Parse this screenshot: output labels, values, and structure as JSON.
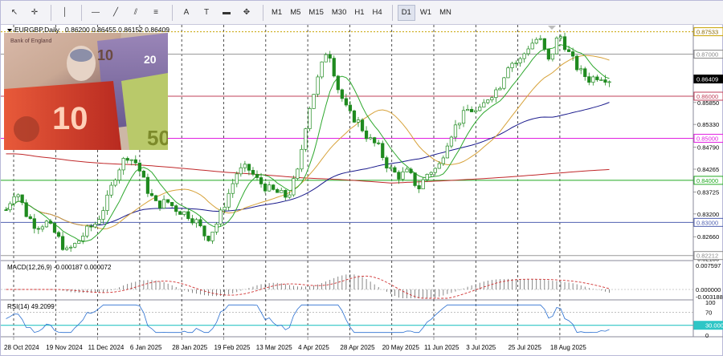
{
  "toolbar": {
    "tools": [
      {
        "name": "cursor-icon",
        "glyph": "↖"
      },
      {
        "name": "crosshair-icon",
        "glyph": "✛"
      },
      {
        "name": "vertical-line-icon",
        "glyph": "│"
      },
      {
        "name": "horizontal-line-icon",
        "glyph": "—"
      },
      {
        "name": "trendline-icon",
        "glyph": "╱"
      },
      {
        "name": "channel-icon",
        "glyph": "⫽"
      },
      {
        "name": "fibonacci-icon",
        "glyph": "≡"
      },
      {
        "name": "text-icon",
        "glyph": "A"
      },
      {
        "name": "text-label-icon",
        "glyph": "T"
      },
      {
        "name": "rectangle-icon",
        "glyph": "▬"
      },
      {
        "name": "shapes-icon",
        "glyph": "✥"
      }
    ],
    "timeframes": [
      "M1",
      "M5",
      "M15",
      "M30",
      "H1",
      "H4",
      "D1",
      "W1",
      "MN"
    ],
    "active_timeframe": "D1"
  },
  "chart_header": {
    "symbol": "EURGBP,Daily",
    "quote": "0.86200 0.86455 0.86152 0.86409"
  },
  "price_axis": {
    "tick_labels": [
      "0.87533",
      "0.87000",
      "0.86409",
      "0.86000",
      "0.85850",
      "0.85330",
      "0.85000",
      "0.84790",
      "0.84265",
      "0.84000",
      "0.83725",
      "0.83200",
      "0.83000",
      "0.82660",
      "0.82212",
      "0.82135"
    ],
    "badges": [
      {
        "label": "0.87533",
        "kind": "dotted-level",
        "color": "#c8a200"
      },
      {
        "label": "0.87000",
        "kind": "level",
        "color": "#8a8a8a"
      },
      {
        "label": "0.86409",
        "kind": "current-price",
        "color": "#000000"
      },
      {
        "label": "0.86000",
        "kind": "level",
        "color": "#c0405a"
      },
      {
        "label": "0.85000",
        "kind": "level",
        "color": "#e020e0"
      },
      {
        "label": "0.84000",
        "kind": "level",
        "color": "#22aa22"
      },
      {
        "label": "0.83000",
        "kind": "level",
        "color": "#5060b0"
      },
      {
        "label": "0.82212",
        "kind": "level",
        "color": "#8a8a8a"
      }
    ]
  },
  "date_axis": {
    "labels": [
      "28 Oct 2024",
      "19 Nov 2024",
      "11 Dec 2024",
      "6 Jan 2025",
      "28 Jan 2025",
      "19 Feb 2025",
      "13 Mar 2025",
      "4 Apr 2025",
      "28 Apr 2025",
      "20 May 2025",
      "11 Jun 2025",
      "3 Jul 2025",
      "25 Jul 2025",
      "18 Aug 2025"
    ]
  },
  "macd": {
    "label": "MACD(12,26,9) -0.000187 0.000072",
    "axis": [
      "0.007597",
      "0.000000",
      "-0.003188"
    ]
  },
  "rsi": {
    "label": "RSI(14) 49.2099",
    "axis": [
      "100",
      "70",
      "30.0000",
      "0"
    ]
  },
  "colors": {
    "candle": "#1f8a1f",
    "ma_fast": "#2ea82e",
    "ma_mid": "#d7a23a",
    "ma_slow": "#1a1a8c",
    "ma_long": "#c0282a",
    "level_pink": "#e020e0",
    "level_green": "#22aa22",
    "level_blue": "#5060b0",
    "macd_signal": "#d03030",
    "rsi_line": "#2a6fd0",
    "rsi_band": "#2ec6c6"
  },
  "chart_data": {
    "type": "candlestick",
    "symbol": "EURGBP",
    "timeframe": "Daily",
    "ylim": [
      0.8213,
      0.8762
    ],
    "x_labels": [
      "28 Oct 2024",
      "19 Nov 2024",
      "11 Dec 2024",
      "6 Jan 2025",
      "28 Jan 2025",
      "19 Feb 2025",
      "13 Mar 2025",
      "4 Apr 2025",
      "28 Apr 2025",
      "20 May 2025",
      "11 Jun 2025",
      "3 Jul 2025",
      "25 Jul 2025",
      "18 Aug 2025"
    ],
    "close_path": [
      0.833,
      0.838,
      0.832,
      0.829,
      0.83,
      0.827,
      0.823,
      0.825,
      0.828,
      0.83,
      0.835,
      0.842,
      0.846,
      0.844,
      0.838,
      0.834,
      0.835,
      0.833,
      0.832,
      0.83,
      0.826,
      0.83,
      0.836,
      0.842,
      0.843,
      0.84,
      0.838,
      0.837,
      0.836,
      0.842,
      0.856,
      0.864,
      0.872,
      0.862,
      0.856,
      0.854,
      0.85,
      0.848,
      0.843,
      0.841,
      0.842,
      0.838,
      0.842,
      0.843,
      0.85,
      0.854,
      0.857,
      0.856,
      0.86,
      0.862,
      0.868,
      0.868,
      0.872,
      0.874,
      0.868,
      0.875,
      0.87,
      0.866,
      0.864,
      0.865,
      0.864
    ],
    "horizontal_levels": [
      0.87533,
      0.87,
      0.86,
      0.85,
      0.84,
      0.83,
      0.82212
    ],
    "macd_axis": [
      0.007597,
      0.0,
      -0.003188
    ],
    "rsi_levels": [
      70,
      30
    ]
  },
  "logo": {
    "label": "Bank of England"
  }
}
